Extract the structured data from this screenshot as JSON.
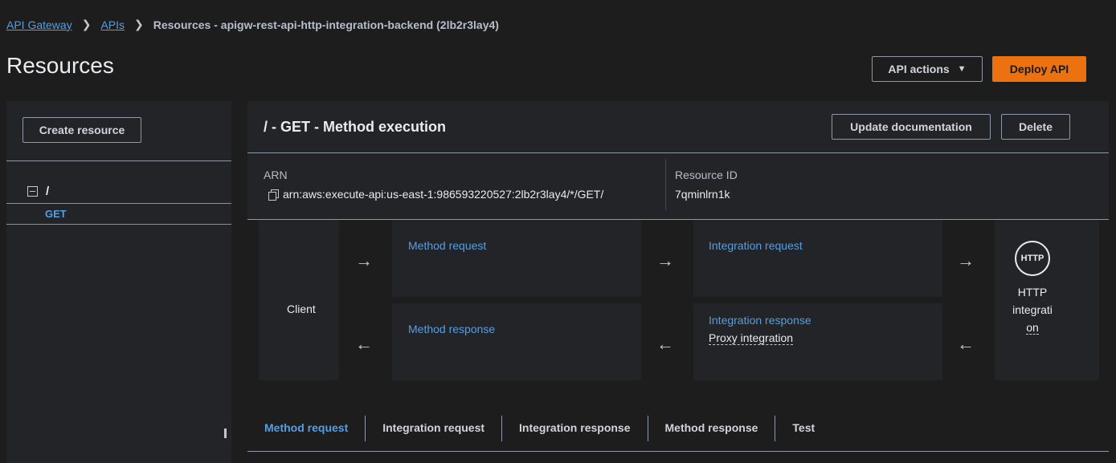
{
  "breadcrumb": {
    "items": [
      "API Gateway",
      "APIs"
    ],
    "current": "Resources - apigw-rest-api-http-integration-backend (2lb2r3lay4)"
  },
  "page": {
    "title": "Resources",
    "api_actions_label": "API actions",
    "deploy_label": "Deploy API"
  },
  "sidebar": {
    "create_resource_label": "Create resource",
    "root_label": "/",
    "method_label": "GET"
  },
  "panel": {
    "title": "/ - GET - Method execution",
    "update_doc_label": "Update documentation",
    "delete_label": "Delete",
    "arn_label": "ARN",
    "arn_value": "arn:aws:execute-api:us-east-1:986593220527:2lb2r3lay4/*/GET/",
    "resource_id_label": "Resource ID",
    "resource_id_value": "7qminlrn1k"
  },
  "flow": {
    "client": "Client",
    "method_request": "Method request",
    "integration_request": "Integration request",
    "method_response": "Method response",
    "integration_response": "Integration response",
    "proxy_integration": "Proxy integration",
    "http_icon_text": "HTTP",
    "http_label_1": "HTTP",
    "http_label_2": "integrati",
    "http_label_3": "on"
  },
  "tabs": [
    "Method request",
    "Integration request",
    "Integration response",
    "Method response",
    "Test"
  ],
  "colors": {
    "accent": "#539fe5",
    "primary_button": "#ec7211",
    "background": "#1d1d1e",
    "panel": "#232427"
  }
}
